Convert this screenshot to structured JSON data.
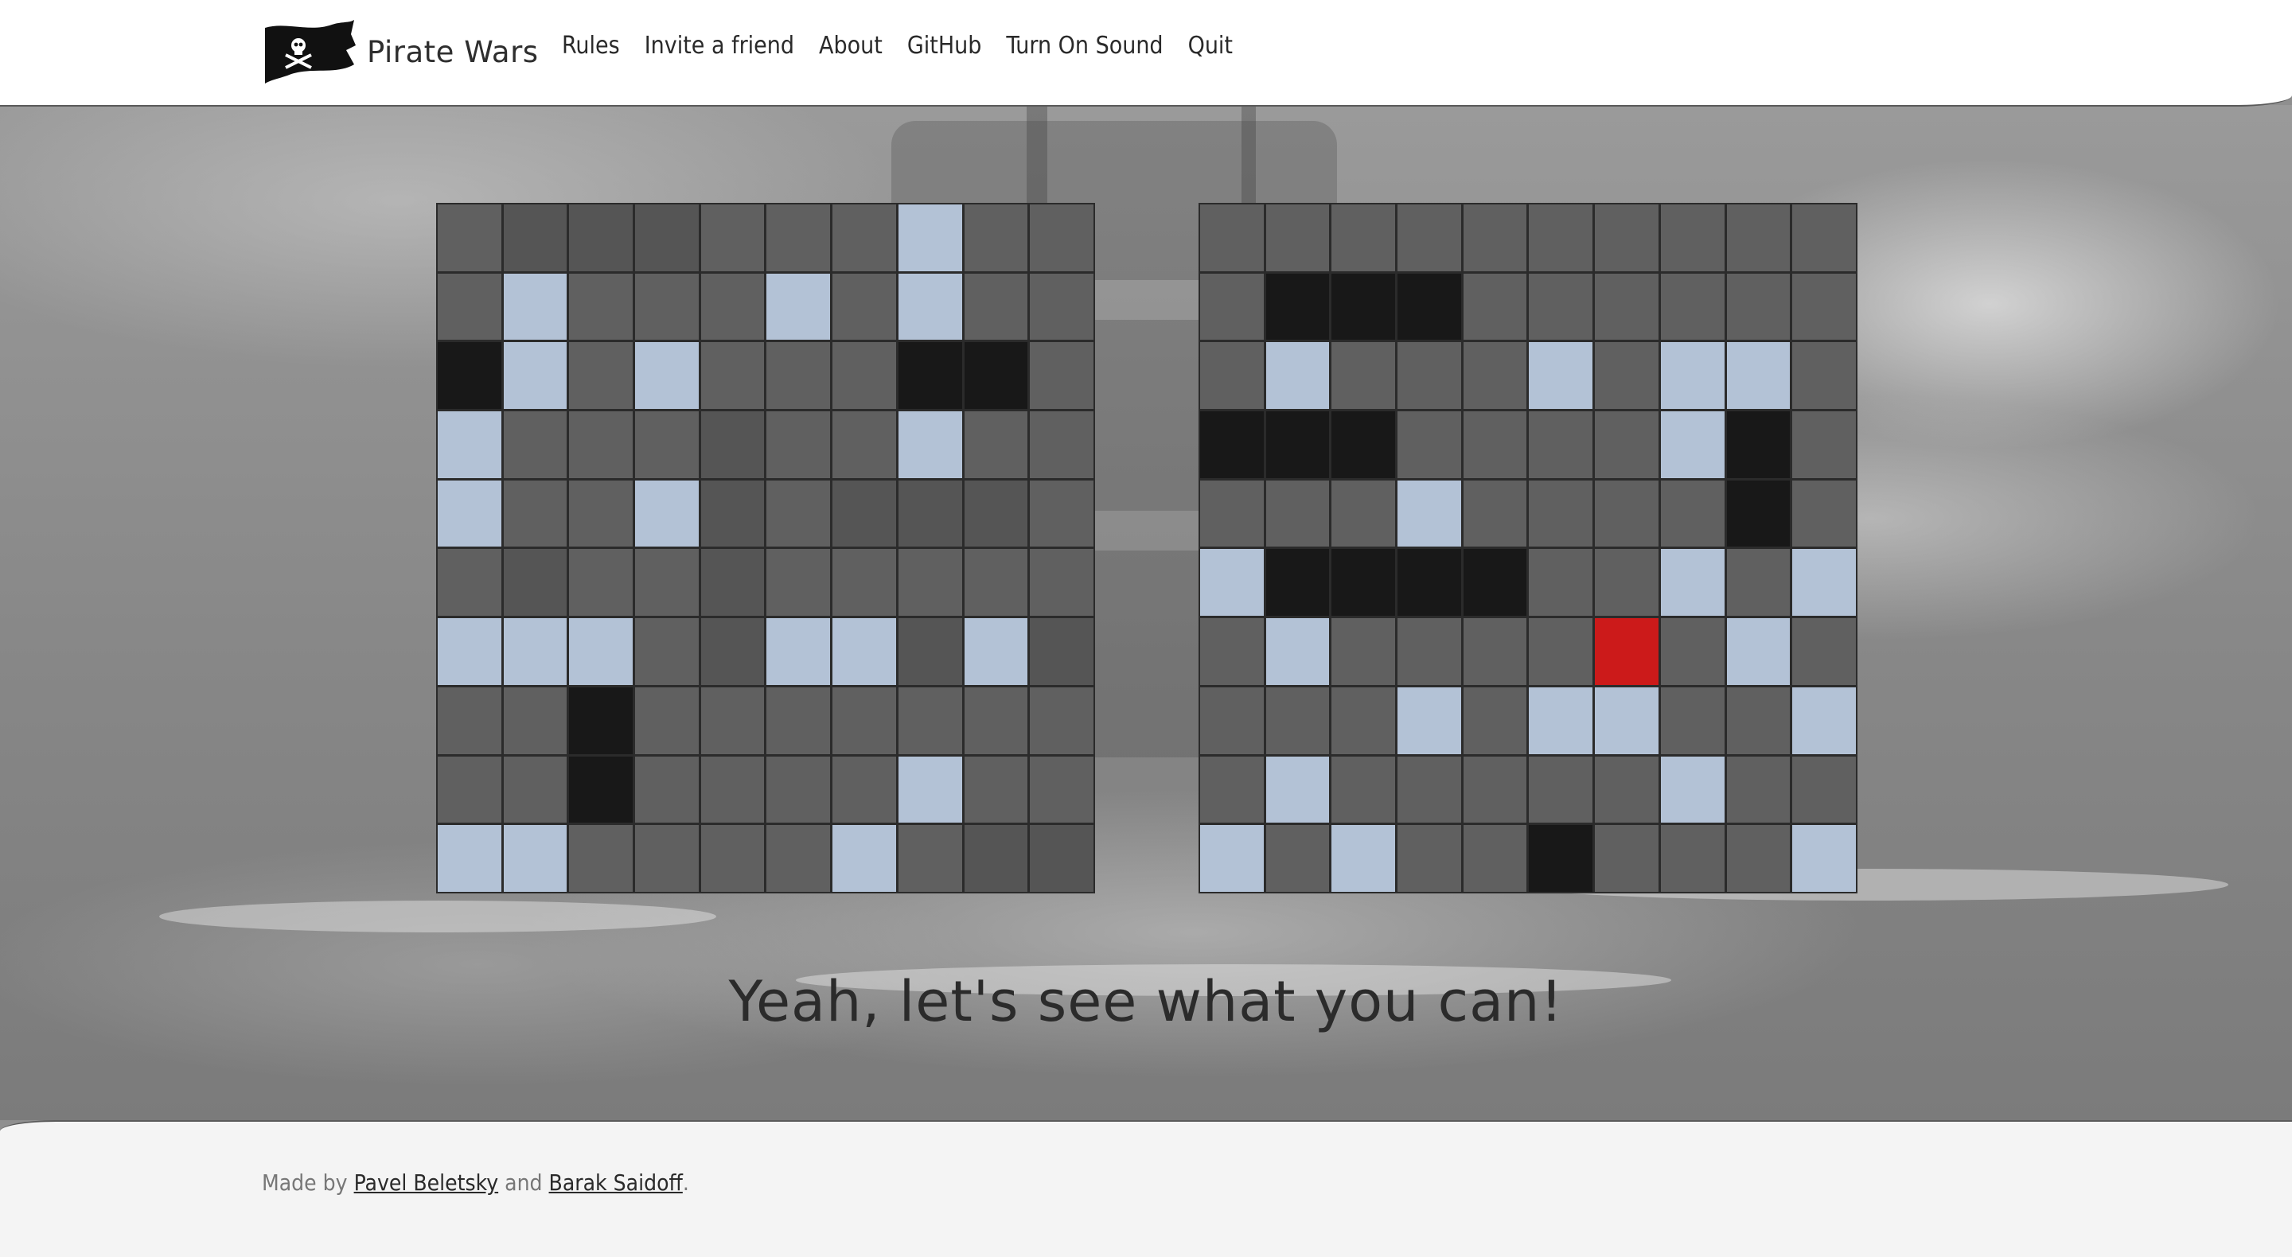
{
  "app": {
    "title": "Pirate Wars",
    "logo": "jolly-roger-flag-icon"
  },
  "nav": {
    "items": [
      {
        "label": "Rules"
      },
      {
        "label": "Invite a friend"
      },
      {
        "label": "About"
      },
      {
        "label": "GitHub"
      },
      {
        "label": "Turn On Sound"
      },
      {
        "label": "Quit"
      }
    ]
  },
  "legend_colors": {
    "empty": "#8c8c8c",
    "miss": "#b3c2d6",
    "ship": "#555555",
    "hit": "#181818",
    "current": "#cc1a1a"
  },
  "boards": {
    "left": {
      "rows": [
        ".SSS...M..",
        ".M...M.M.",
        "HM.M...HH.",
        "M...S..M..",
        "M..MS.SSS.",
        ".S..S.....",
        "MMM.SMMSMS",
        "..H.......",
        "..H....M..",
        "MM....M.SS"
      ]
    },
    "right": {
      "rows": [
        "..........",
        ".HHH......",
        ".M...M.MM.",
        "HHH....MH.",
        "...M....H.",
        "MHHHH..M.M",
        ".M....C.M.",
        "...M.MM..M",
        ".M.....M..",
        "M.M..H...M"
      ]
    }
  },
  "message": "Yeah, let's see what you can!",
  "footer": {
    "prefix": "Made by",
    "author1": "Pavel Beletsky",
    "conjunction": "and",
    "author2": "Barak Saidoff",
    "suffix": "."
  }
}
